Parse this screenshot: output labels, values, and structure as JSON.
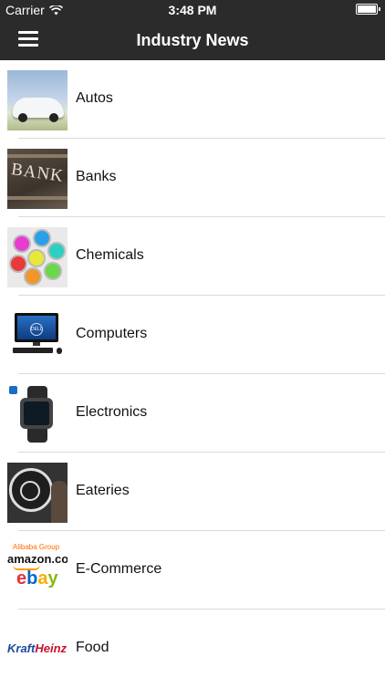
{
  "status_bar": {
    "carrier": "Carrier",
    "time": "3:48 PM"
  },
  "nav": {
    "title": "Industry News",
    "menu_icon": "hamburger-menu-icon"
  },
  "industries": [
    {
      "label": "Autos"
    },
    {
      "label": "Banks"
    },
    {
      "label": "Chemicals"
    },
    {
      "label": "Computers"
    },
    {
      "label": "Electronics"
    },
    {
      "label": "Eateries"
    },
    {
      "label": "E-Commerce"
    },
    {
      "label": "Food"
    }
  ],
  "thumbnail_text": {
    "banks": "BANK",
    "computers": "DELL",
    "ecommerce_alibaba": "Alibaba Group",
    "ecommerce_amazon": "amazon.com",
    "ecommerce_ebay": "ebay",
    "food_kraft": "Kraft",
    "food_heinz": "Heinz"
  },
  "colors": {
    "nav_background": "#2b2b2b",
    "nav_text": "#ffffff",
    "separator": "#d9d9d9"
  }
}
